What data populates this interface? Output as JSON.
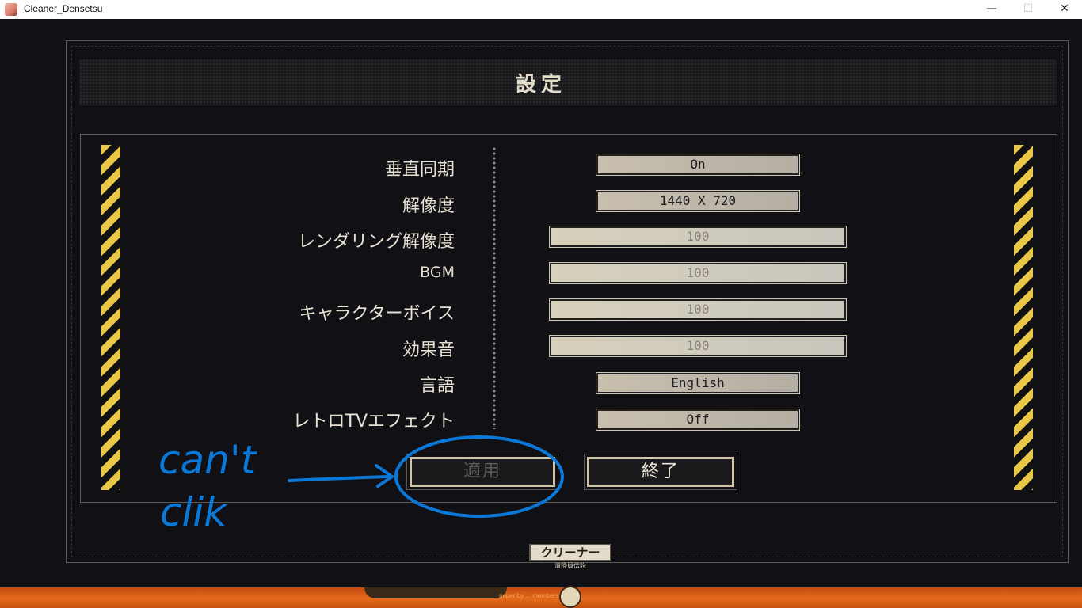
{
  "window": {
    "title": "Cleaner_Densetsu",
    "minimize_glyph": "—",
    "maximize_glyph": "☐",
    "close_glyph": "✕"
  },
  "settings": {
    "title": "設定",
    "rows": [
      {
        "label": "垂直同期",
        "value": "On",
        "control": "select"
      },
      {
        "label": "解像度",
        "value": "1440 X 720",
        "control": "select"
      },
      {
        "label": "レンダリング解像度",
        "value": "100",
        "control": "slider"
      },
      {
        "label": "BGM",
        "value": "100",
        "control": "slider"
      },
      {
        "label": "キャラクターボイス",
        "value": "100",
        "control": "slider"
      },
      {
        "label": "効果音",
        "value": "100",
        "control": "slider"
      },
      {
        "label": "言語",
        "value": "English",
        "control": "select"
      },
      {
        "label": "レトロTVエフェクト",
        "value": "Off",
        "control": "select"
      }
    ],
    "apply_label": "適用",
    "exit_label": "終了"
  },
  "logo": {
    "text": "クリーナー",
    "subtitle": "清掃員伝説"
  },
  "annotation": {
    "text_line1": "can't",
    "text_line2": "clik",
    "color": "#0a78d8"
  },
  "bottom_strip": {
    "credit": "paper by ... membership"
  },
  "colors": {
    "hazard_yellow": "#e9c747",
    "text_light": "#e6e0d2",
    "background": "#111115"
  }
}
